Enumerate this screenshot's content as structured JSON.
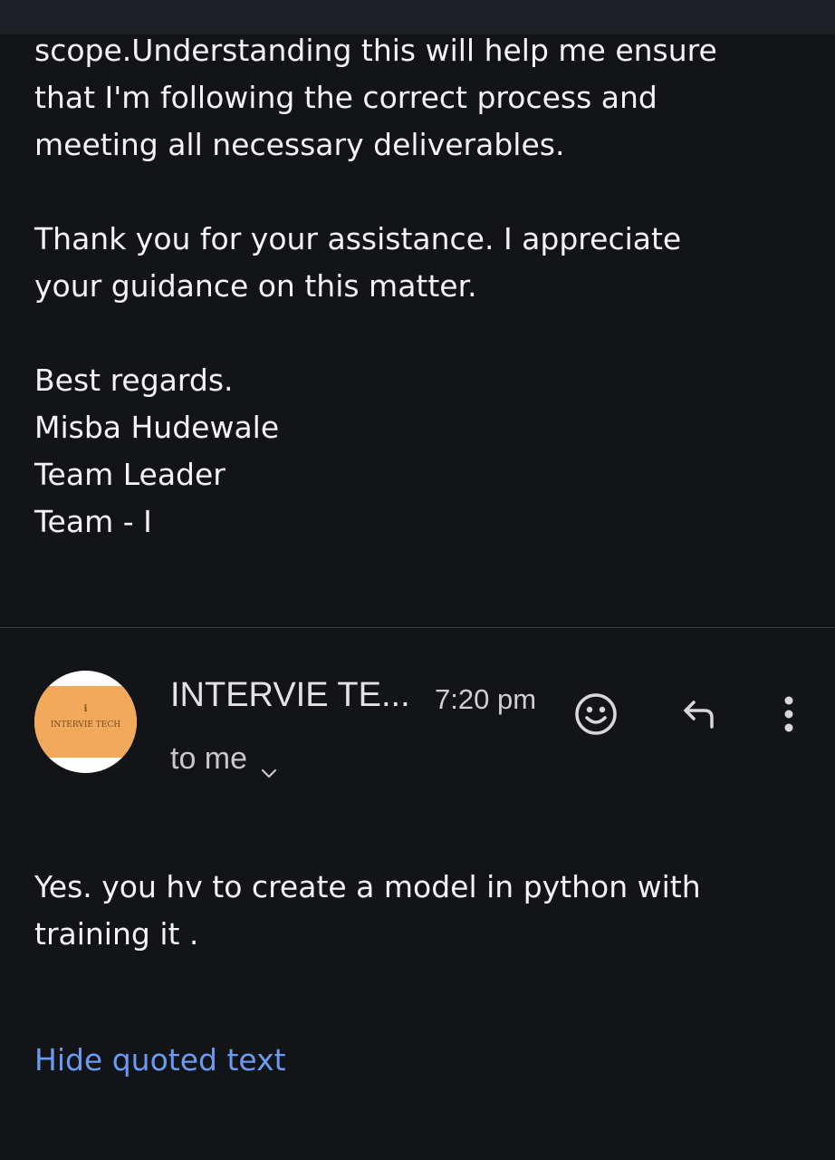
{
  "previous_message": {
    "paragraphs": [
      {
        "lines": [
          "scope.Understanding this will help me ensure",
          "that I'm following the correct process and",
          "meeting all necessary deliverables."
        ]
      },
      {
        "lines": [
          "Thank you for your assistance. I appreciate",
          "your guidance on this matter."
        ]
      },
      {
        "lines": [
          "Best regards.",
          "Misba Hudewale",
          "Team Leader",
          "Team - I"
        ]
      }
    ]
  },
  "message": {
    "avatar": {
      "initial": "i",
      "label": "INTERVIE TECH",
      "colors": {
        "band": "#f2a95b",
        "text": "#7a4a24"
      }
    },
    "sender": "INTERVIE TE...",
    "time": "7:20 pm",
    "recipient": "to me",
    "icons": {
      "emoji": "smiley-face-icon",
      "reply": "reply-arrow-icon",
      "more": "more-vert-icon",
      "expand": "chevron-down-icon"
    },
    "body_lines": [
      "Yes. you hv to create a model in python with",
      "training it ."
    ],
    "hide_quoted_label": "Hide quoted text"
  },
  "colors": {
    "background": "#121418",
    "link": "#6a9bf0",
    "divider": "#3c3f44"
  }
}
